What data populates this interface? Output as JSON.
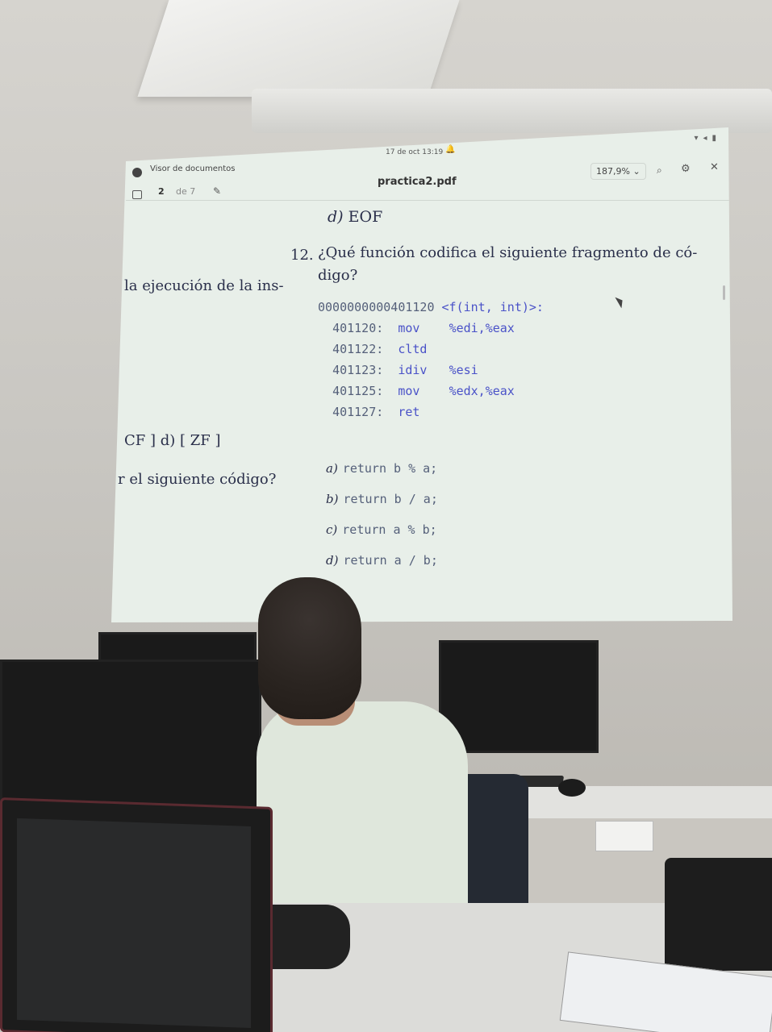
{
  "topbar": {
    "clock": "17 de oct  13:19"
  },
  "viewer": {
    "app_title": "Visor de documentos",
    "document_title": "practica2.pdf",
    "page_current": "2",
    "page_total": "de 7",
    "zoom": "187,9%",
    "zoom_chevron": "⌄"
  },
  "page": {
    "prev_option_letter": "d)",
    "prev_option_text": "EOF",
    "question_number": "12.",
    "question_text": "¿Qué función codifica el siguiente fragmento de có-digo?",
    "left_fragment_1": "la ejecución de la ins-",
    "left_fragment_2": "CF ]   d) [ ZF ]",
    "left_fragment_3": "r el siguiente código?",
    "code": {
      "header_addr": "0000000000401120 ",
      "header_fn": "<f(int, int)>:",
      "rows": [
        {
          "addr": "401120:",
          "op": "mov ",
          "args": "%edi,%eax"
        },
        {
          "addr": "401122:",
          "op": "cltd",
          "args": ""
        },
        {
          "addr": "401123:",
          "op": "idiv",
          "args": "%esi"
        },
        {
          "addr": "401125:",
          "op": "mov ",
          "args": "%edx,%eax"
        },
        {
          "addr": "401127:",
          "op": "ret ",
          "args": ""
        }
      ]
    },
    "answers": [
      {
        "letter": "a)",
        "text": "return b % a;"
      },
      {
        "letter": "b)",
        "text": "return b / a;"
      },
      {
        "letter": "c)",
        "text": "return a % b;"
      },
      {
        "letter": "d)",
        "text": "return a / b;"
      }
    ]
  }
}
